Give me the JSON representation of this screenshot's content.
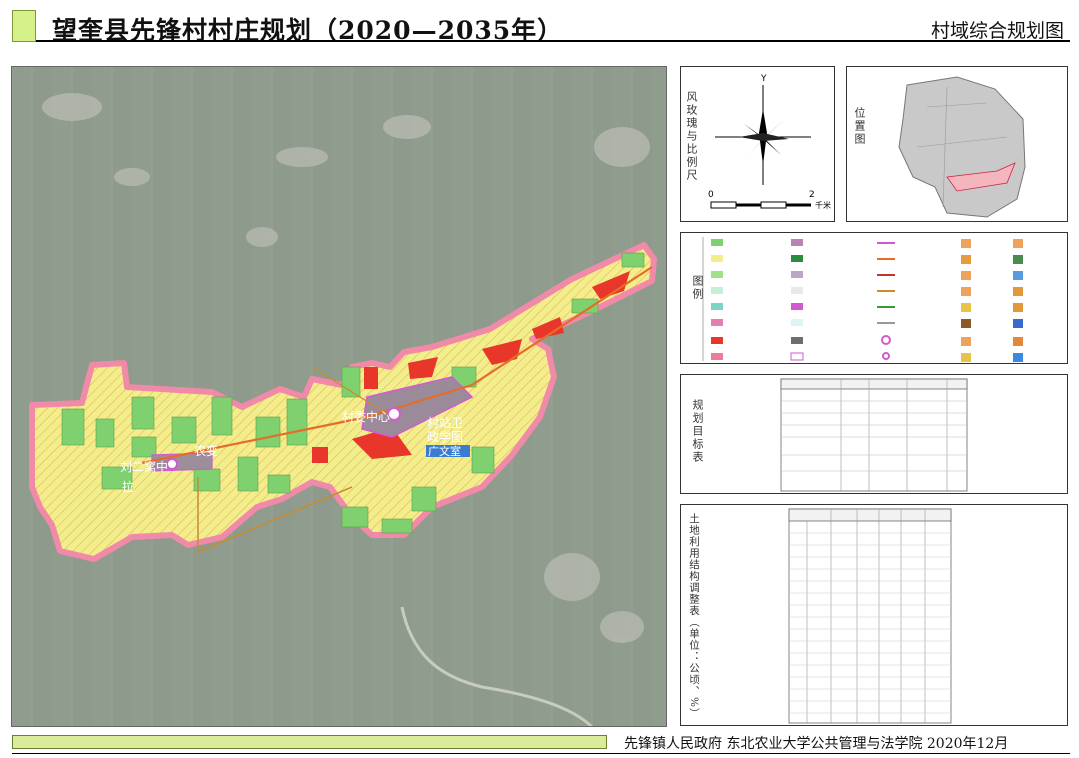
{
  "header": {
    "title": "望奎县先锋村村庄规划（2020—2035年）",
    "subtitle": "村域综合规划图"
  },
  "map": {
    "labels": {
      "center": "村委中心",
      "gov": "村站卫",
      "gov2": "政学图",
      "gov3": "广文室",
      "west1": "刘二窝中",
      "west2": "拉",
      "west3": "农变"
    }
  },
  "compass": {
    "side_label": "风玫瑰与比例尺",
    "north": "Y",
    "scale_start": "0",
    "scale_end": "2",
    "scale_unit": "千米"
  },
  "location": {
    "label": "位置图"
  },
  "legend": {
    "label": "图例"
  },
  "targets": {
    "label": "规划目标表"
  },
  "landuse": {
    "label": "土地利用结构调整表（单位：公顷、%）"
  },
  "footer": {
    "text": "先锋镇人民政府    东北农业大学公共管理与法学院    2020年12月"
  },
  "colors": {
    "field_yellow": "#f3ee8c",
    "forest_green": "#7fd16f",
    "construction_red": "#e8362a",
    "road_purple": "#d25ad0",
    "boundary_pink": "#f08aa8",
    "satellite_bg": "#8e9b8c"
  }
}
